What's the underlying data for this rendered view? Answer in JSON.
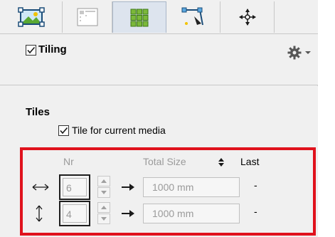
{
  "tabs": [
    {
      "icon": "image-frame-icon",
      "active": false
    },
    {
      "icon": "layout-grid-icon",
      "active": false
    },
    {
      "icon": "tiles-grid-icon",
      "active": true
    },
    {
      "icon": "path-edit-icon",
      "active": false
    },
    {
      "icon": "crosshair-icon",
      "active": false
    }
  ],
  "tiling": {
    "label": "Tiling",
    "checked": true
  },
  "tiles": {
    "heading": "Tiles",
    "tile_for_media_label": "Tile for current media",
    "tile_for_media_checked": true,
    "columns": {
      "nr": "Nr",
      "total_size": "Total Size",
      "last": "Last"
    },
    "rows": [
      {
        "name": "horizontal",
        "nr": "6",
        "size": "1000 mm",
        "last": "-"
      },
      {
        "name": "vertical",
        "nr": "4",
        "size": "1000 mm",
        "last": "-"
      }
    ]
  },
  "colors": {
    "panel_bg": "#f0f0f0",
    "highlight": "#e0121d",
    "active_tab": "#dde4ee",
    "disabled_text": "#9a9a9a"
  }
}
